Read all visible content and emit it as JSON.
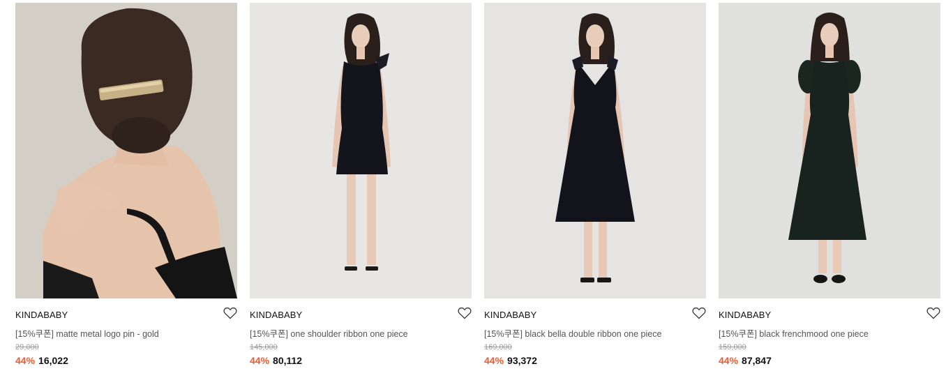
{
  "accent_color": "#f2592a",
  "products": [
    {
      "brand": "KINDABABY",
      "name": "[15%쿠폰] matte metal logo pin - gold",
      "original_price": "29,000",
      "discount": "44%",
      "price": "16,022",
      "image_subject": "woman with dark hair wearing a gold metal hair pin, back view, black spaghetti-strap top"
    },
    {
      "brand": "KINDABABY",
      "name": "[15%쿠폰] one shoulder ribbon one piece",
      "original_price": "145,000",
      "discount": "44%",
      "price": "80,112",
      "image_subject": "model standing in black sleeveless mini dress with shoulder ribbon"
    },
    {
      "brand": "KINDABABY",
      "name": "[15%쿠폰] black bella double ribbon one piece",
      "original_price": "169,000",
      "discount": "44%",
      "price": "93,372",
      "image_subject": "model standing in black V-neck midi dress with two shoulder ribbons"
    },
    {
      "brand": "KINDABABY",
      "name": "[15%쿠폰] black frenchmood one piece",
      "original_price": "159,000",
      "discount": "44%",
      "price": "87,847",
      "image_subject": "model standing in dark green puff-sleeve long dress"
    }
  ]
}
